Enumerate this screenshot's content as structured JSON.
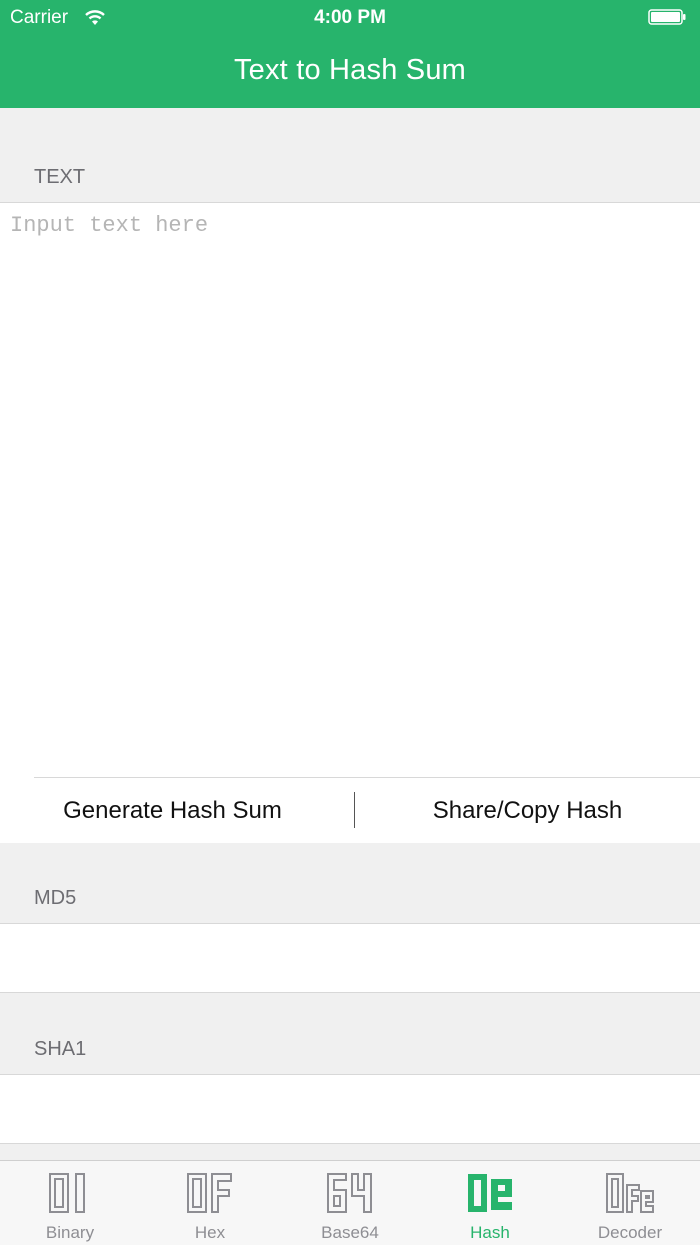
{
  "status_bar": {
    "carrier": "Carrier",
    "time": "4:00 PM"
  },
  "nav": {
    "title": "Text to Hash Sum"
  },
  "text_section": {
    "label": "TEXT",
    "placeholder": "Input text here",
    "value": ""
  },
  "actions": {
    "generate_label": "Generate Hash Sum",
    "share_label": "Share/Copy Hash"
  },
  "results": [
    {
      "label": "MD5",
      "value": ""
    },
    {
      "label": "SHA1",
      "value": ""
    }
  ],
  "tabs": [
    {
      "label": "Binary",
      "icon": "binary-01-icon",
      "active": false
    },
    {
      "label": "Hex",
      "icon": "hex-0f-icon",
      "active": false
    },
    {
      "label": "Base64",
      "icon": "base64-64-icon",
      "active": false
    },
    {
      "label": "Hash",
      "icon": "hash-0e-icon",
      "active": true
    },
    {
      "label": "Decoder",
      "icon": "decoder-0fe-icon",
      "active": false
    }
  ],
  "colors": {
    "accent": "#27b46c",
    "tab_inactive": "#8e8e93",
    "background": "#f0f0f0"
  }
}
